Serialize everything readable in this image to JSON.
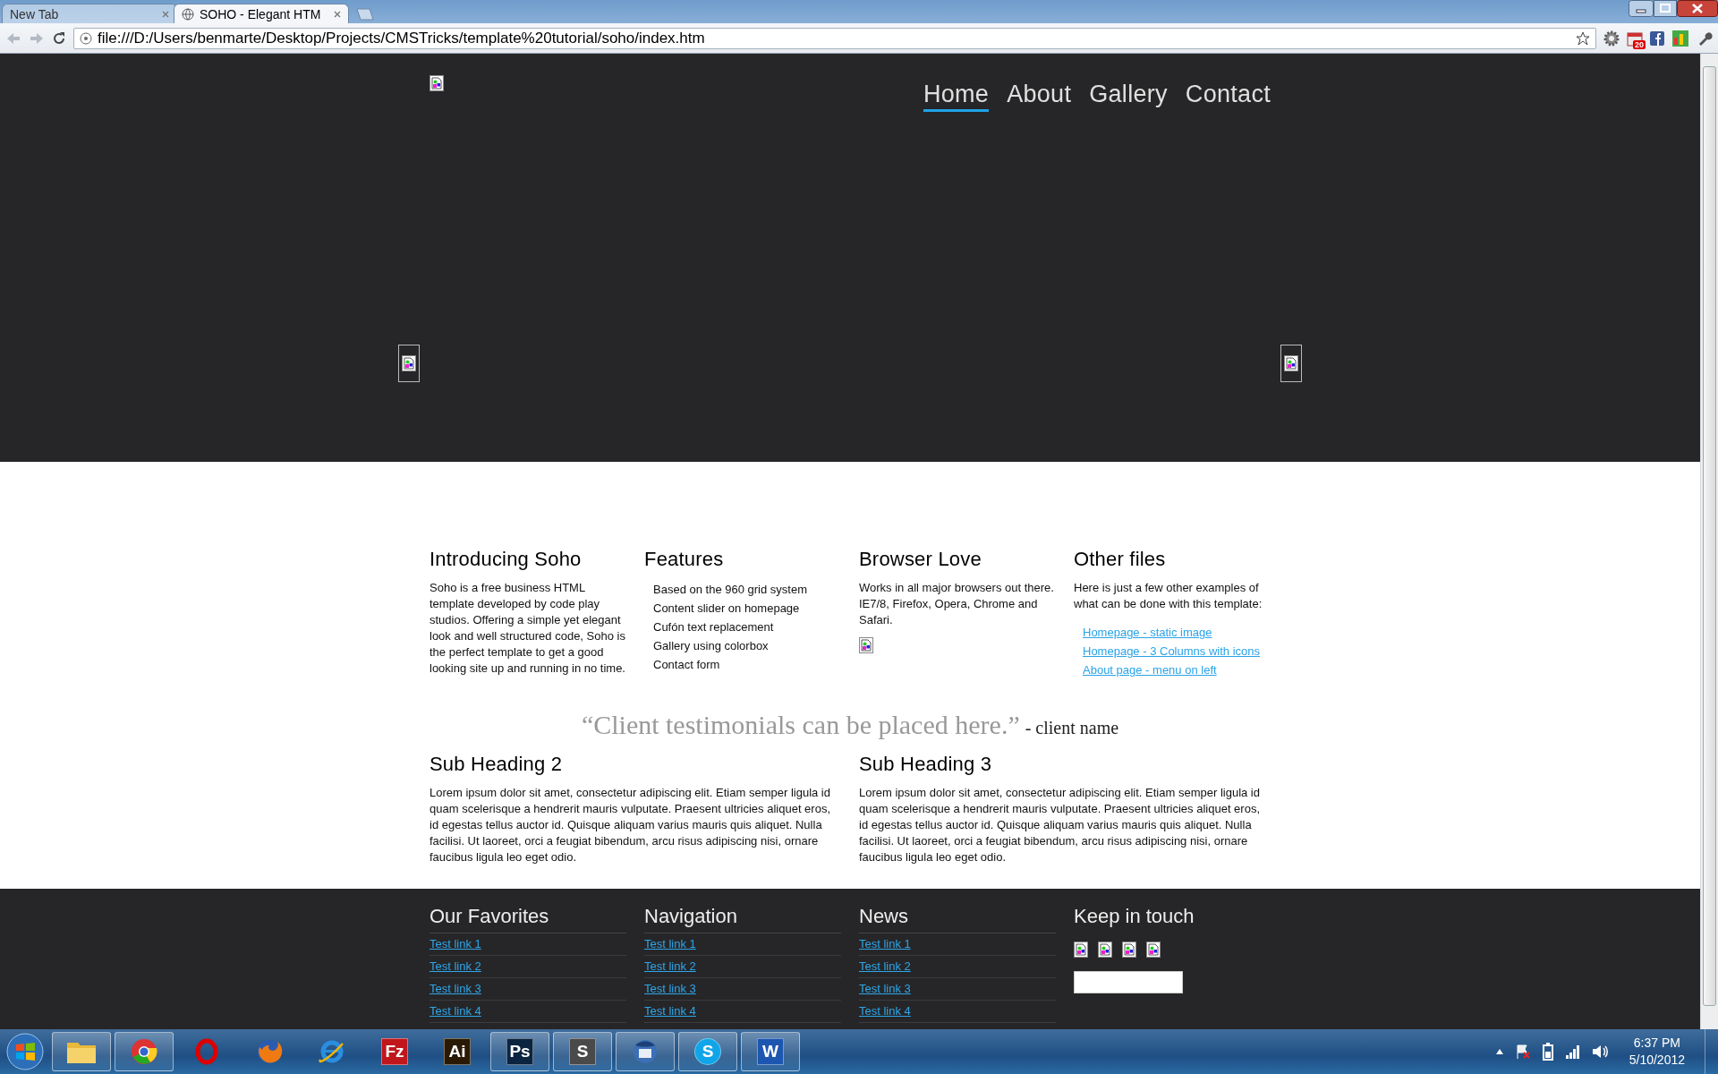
{
  "browser": {
    "tabs": [
      {
        "title": "New Tab",
        "selected": false
      },
      {
        "title": "SOHO - Elegant HTM",
        "selected": true
      }
    ],
    "address": "file:///D:/Users/benmarte/Desktop/Projects/CMSTricks/template%20tutorial/soho/index.htm",
    "extension_badge": "20"
  },
  "header": {
    "nav": [
      {
        "label": "Home",
        "selected": true
      },
      {
        "label": "About",
        "selected": false
      },
      {
        "label": "Gallery",
        "selected": false
      },
      {
        "label": "Contact",
        "selected": false
      }
    ]
  },
  "intro_columns": [
    {
      "kind": "text",
      "heading": "Introducing Soho",
      "text": "Soho is a free business HTML template developed by code play studios. Offering a simple yet elegant look and well structured code, Soho is the perfect template to get a good looking site up and running in no time."
    },
    {
      "kind": "list",
      "heading": "Features",
      "items": [
        "Based on the 960 grid system",
        "Content slider on homepage",
        "Cufón text replacement",
        "Gallery using colorbox",
        "Contact form"
      ]
    },
    {
      "kind": "image",
      "heading": "Browser Love",
      "text": "Works in all major browsers out there. IE7/8, Firefox, Opera, Chrome and Safari."
    },
    {
      "kind": "links",
      "heading": "Other files",
      "text": "Here is just a few other examples of what can be done with this template:",
      "links": [
        "Homepage - static image",
        "Homepage - 3 Columns with icons",
        "About page - menu on left"
      ]
    }
  ],
  "testimonial": {
    "quote": "“Client testimonials can be placed here.”",
    "author": "- client name"
  },
  "sections": [
    {
      "heading": "Sub Heading 2",
      "text": "Lorem ipsum dolor sit amet, consectetur adipiscing elit. Etiam semper ligula id quam scelerisque a hendrerit mauris vulputate. Praesent ultricies aliquet eros, id egestas tellus auctor id. Quisque aliquam varius mauris quis aliquet. Nulla facilisi. Ut laoreet, orci a feugiat bibendum, arcu risus adipiscing nisi, ornare faucibus ligula leo eget odio."
    },
    {
      "heading": "Sub Heading 3",
      "text": "Lorem ipsum dolor sit amet, consectetur adipiscing elit. Etiam semper ligula id quam scelerisque a hendrerit mauris vulputate. Praesent ultricies aliquet eros, id egestas tellus auctor id. Quisque aliquam varius mauris quis aliquet. Nulla facilisi. Ut laoreet, orci a feugiat bibendum, arcu risus adipiscing nisi, ornare faucibus ligula leo eget odio."
    }
  ],
  "footer": {
    "columns": [
      {
        "heading": "Our Favorites",
        "links": [
          "Test link 1",
          "Test link 2",
          "Test link 3",
          "Test link 4"
        ]
      },
      {
        "heading": "Navigation",
        "links": [
          "Test link 1",
          "Test link 2",
          "Test link 3",
          "Test link 4"
        ]
      },
      {
        "heading": "News",
        "links": [
          "Test link 1",
          "Test link 2",
          "Test link 3",
          "Test link 4"
        ]
      }
    ],
    "contact": {
      "heading": "Keep in touch"
    }
  },
  "taskbar": {
    "apps": [
      {
        "kind": "folder",
        "running": true
      },
      {
        "kind": "chrome",
        "running": true
      },
      {
        "kind": "opera",
        "running": false
      },
      {
        "kind": "firefox",
        "running": false
      },
      {
        "kind": "ie",
        "running": false
      },
      {
        "kind": "tile",
        "glyph": "Fz",
        "color": "#c0171c",
        "running": false
      },
      {
        "kind": "tile",
        "glyph": "Ai",
        "color": "#2a1a03",
        "running": false
      },
      {
        "kind": "tile",
        "glyph": "Ps",
        "color": "#0b2440",
        "running": true
      },
      {
        "kind": "tile",
        "glyph": "S",
        "color": "#4a4a4a",
        "running": true
      },
      {
        "kind": "thunderbird",
        "running": true
      },
      {
        "kind": "round",
        "glyph": "S",
        "color": "#10a5e8",
        "running": true
      },
      {
        "kind": "tile",
        "glyph": "W",
        "color": "#1d56b0",
        "running": true
      }
    ],
    "time": "6:37 PM",
    "date": "5/10/2012"
  }
}
